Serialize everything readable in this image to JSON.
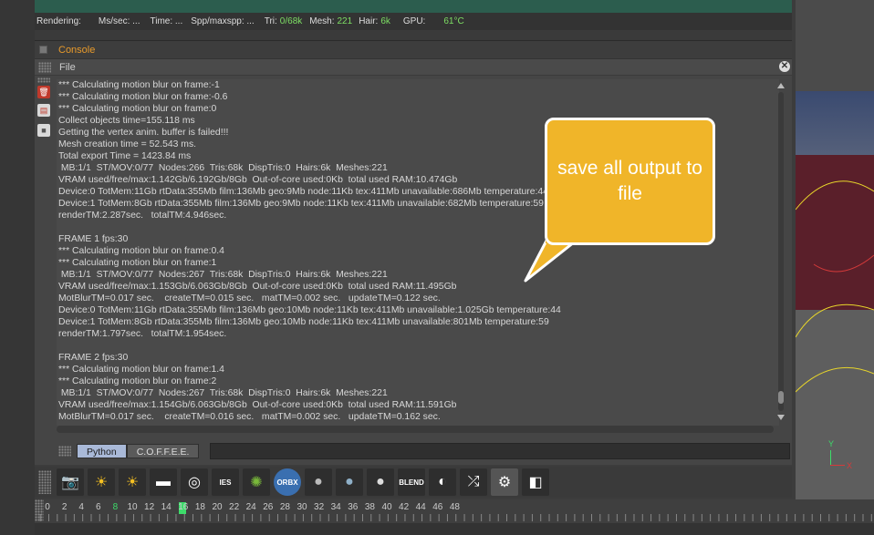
{
  "status_bar": {
    "rendering_label": "Rendering:",
    "ms_sec": "Ms/sec: ...",
    "time": "Time: ...",
    "spp": "Spp/maxspp: ...",
    "tri_label": "Tri:",
    "tri_value": "0/68k",
    "mesh_label": "Mesh:",
    "mesh_value": "221",
    "hair_label": "Hair:",
    "hair_value": "6k",
    "gpu_label": "GPU:",
    "gpu_value": "61°C"
  },
  "console": {
    "title": "Console",
    "file_menu": "File",
    "log_lines": [
      "*** Calculating motion blur on frame:-1",
      "*** Calculating motion blur on frame:-0.6",
      "*** Calculating motion blur on frame:0",
      "Collect objects time=155.118 ms",
      "Getting the vertex anim. buffer is failed!!!",
      "Mesh creation time = 52.543 ms.",
      "Total export Time = 1423.84 ms",
      " MB:1/1  ST/MOV:0/77  Nodes:266  Tris:68k  DispTris:0  Hairs:6k  Meshes:221",
      "VRAM used/free/max:1.142Gb/6.192Gb/8Gb  Out-of-core used:0Kb  total used RAM:10.474Gb",
      "Device:0 TotMem:11Gb rtData:355Mb film:136Mb geo:9Mb node:11Kb tex:411Mb unavailable:686Mb temperature:44",
      "Device:1 TotMem:8Gb rtData:355Mb film:136Mb geo:9Mb node:11Kb tex:411Mb unavailable:682Mb temperature:59",
      "renderTM:2.287sec.   totalTM:4.946sec.",
      "",
      "FRAME 1 fps:30",
      "*** Calculating motion blur on frame:0.4",
      "*** Calculating motion blur on frame:1",
      " MB:1/1  ST/MOV:0/77  Nodes:267  Tris:68k  DispTris:0  Hairs:6k  Meshes:221",
      "VRAM used/free/max:1.153Gb/6.063Gb/8Gb  Out-of-core used:0Kb  total used RAM:11.495Gb",
      "MotBlurTM=0.017 sec.    createTM=0.015 sec.   matTM=0.002 sec.   updateTM=0.122 sec.",
      "Device:0 TotMem:11Gb rtData:355Mb film:136Mb geo:10Mb node:11Kb tex:411Mb unavailable:1.025Gb temperature:44",
      "Device:1 TotMem:8Gb rtData:355Mb film:136Mb geo:10Mb node:11Kb tex:411Mb unavailable:801Mb temperature:59",
      "renderTM:1.797sec.   totalTM:1.954sec.",
      "",
      "FRAME 2 fps:30",
      "*** Calculating motion blur on frame:1.4",
      "*** Calculating motion blur on frame:2",
      " MB:1/1  ST/MOV:0/77  Nodes:267  Tris:68k  DispTris:0  Hairs:6k  Meshes:221",
      "VRAM used/free/max:1.154Gb/6.063Gb/8Gb  Out-of-core used:0Kb  total used RAM:11.591Gb",
      "MotBlurTM=0.017 sec.    createTM=0.016 sec.   matTM=0.002 sec.   updateTM=0.162 sec."
    ],
    "tabs": [
      "Python",
      "C.O.F.F.E.E."
    ],
    "input_value": ""
  },
  "callout": {
    "text": "save all output to file"
  },
  "toolbar": {
    "icons": [
      "camera-icon",
      "sun-light-icon",
      "sun-light-icon",
      "area-light-icon",
      "target-icon",
      "ies-light-icon",
      "gear-texture-icon",
      "orbx-icon",
      "material-sphere-icon",
      "glass-sphere-icon",
      "metal-sphere-icon",
      "blend-material-icon",
      "mix-material-icon",
      "shuffle-icon",
      "settings-gear-icon",
      "panel-icon"
    ],
    "glyphs": [
      "📷",
      "☀",
      "☀",
      "▬",
      "◎",
      "IES",
      "✺",
      "ORBX",
      "●",
      "●",
      "●",
      "BLEND",
      "◐",
      "⤮",
      "⚙",
      "◧"
    ],
    "colors": {
      "accent": "#f0b529",
      "camera": "#d9322b",
      "sun": "#f5c022",
      "orbx": "#3a6fb0",
      "gear_texture": "#79b83a"
    }
  },
  "timeline": {
    "ticks": [
      "0",
      "2",
      "4",
      "6",
      "8",
      "10",
      "12",
      "14",
      "16",
      "18",
      "20",
      "22",
      "24",
      "26",
      "28",
      "30",
      "32",
      "34",
      "36",
      "38",
      "40",
      "42",
      "44",
      "46",
      "48"
    ],
    "current_frame": "8"
  },
  "viewport": {
    "axis_y": "Y",
    "axis_x": "X"
  }
}
